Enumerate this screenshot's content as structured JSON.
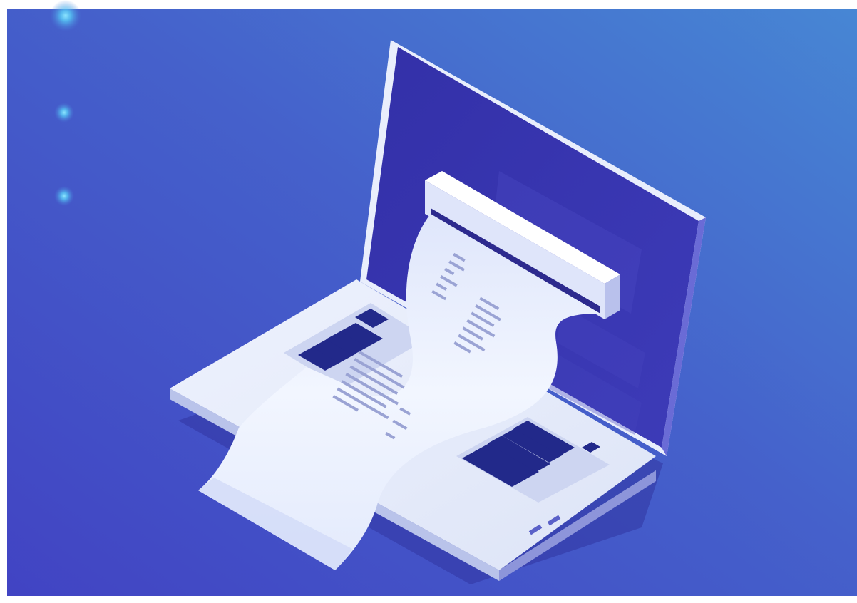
{
  "illustration": {
    "subject": "laptop-printing-receipt-icon",
    "colors": {
      "background_left": "#4349c4",
      "background_right": "#4784d3",
      "screen": "#3834b0",
      "laptop_body": "#e6ebfa",
      "paper": "#e9efff",
      "key_bars": "#22298a",
      "paper_text": "#9aa3d4",
      "glow": "#5cd6ff"
    },
    "decorations": [
      "glow-dot",
      "glow-dot",
      "glow-dot"
    ]
  }
}
